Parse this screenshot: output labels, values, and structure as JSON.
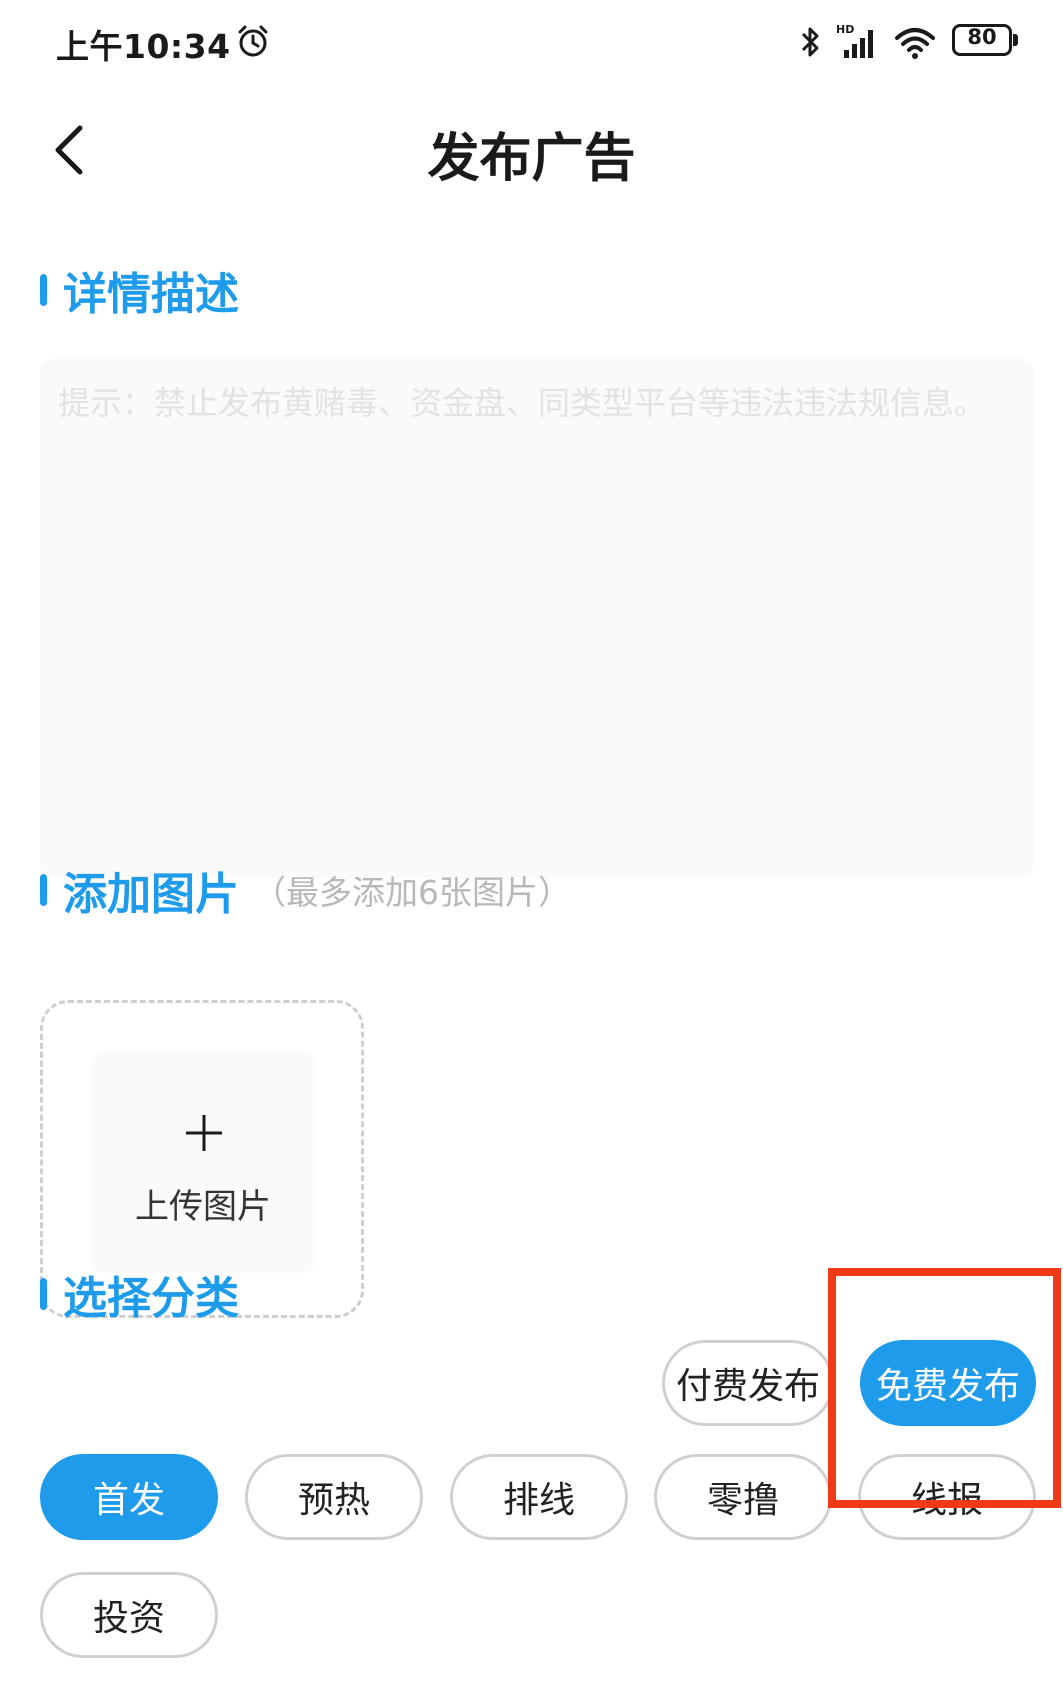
{
  "status_bar": {
    "time": "上午10:34",
    "battery": "80"
  },
  "header": {
    "title": "发布广告"
  },
  "details": {
    "title": "详情描述",
    "placeholder": "提示：禁止发布黄赌毒、资金盘、同类型平台等违法违法规信息。"
  },
  "images": {
    "title": "添加图片",
    "hint": "（最多添加6张图片）",
    "upload_label": "上传图片"
  },
  "category": {
    "title": "选择分类",
    "publish_types": [
      {
        "label": "付费发布",
        "active": false
      },
      {
        "label": "免费发布",
        "active": true
      }
    ],
    "items": [
      {
        "label": "首发",
        "active": true
      },
      {
        "label": "预热",
        "active": false
      },
      {
        "label": "排线",
        "active": false
      },
      {
        "label": "零撸",
        "active": false
      },
      {
        "label": "线报",
        "active": false
      },
      {
        "label": "投资",
        "active": false
      }
    ]
  },
  "colors": {
    "accent": "#1e9bea",
    "highlight": "#f03a17"
  }
}
